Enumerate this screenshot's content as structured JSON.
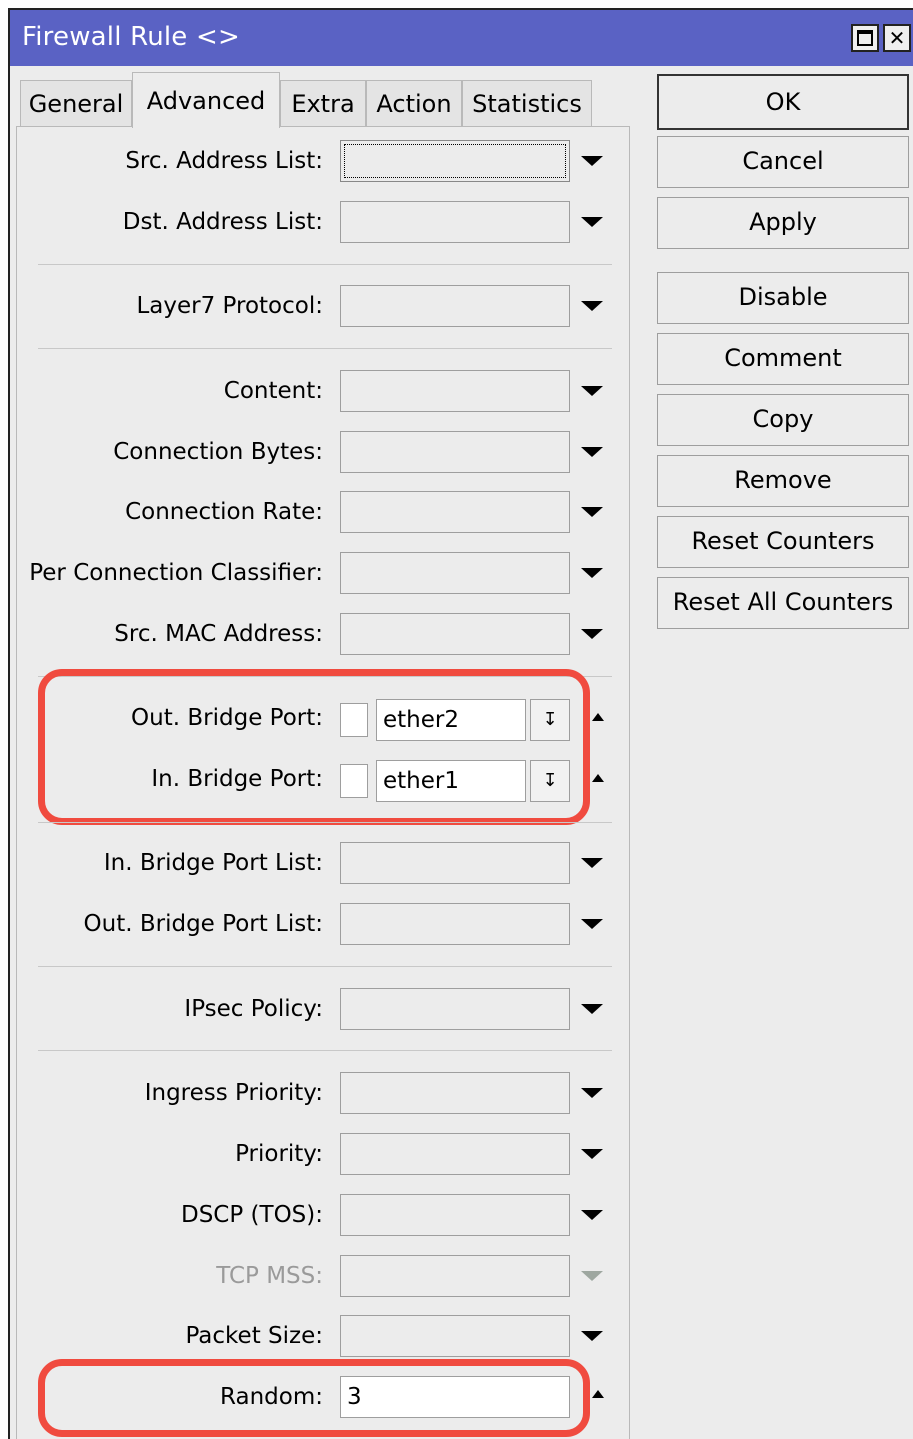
{
  "window": {
    "title": "Firewall Rule <>",
    "close_symbol": "✕"
  },
  "tabs": [
    "General",
    "Advanced",
    "Extra",
    "Action",
    "Statistics"
  ],
  "fields": {
    "src_address_list": "Src. Address List:",
    "dst_address_list": "Dst. Address List:",
    "layer7_protocol": "Layer7 Protocol:",
    "content": "Content:",
    "connection_bytes": "Connection Bytes:",
    "connection_rate": "Connection Rate:",
    "per_connection_classifier": "Per Connection Classifier:",
    "src_mac_address": "Src. MAC Address:",
    "out_bridge_port": "Out. Bridge Port:",
    "in_bridge_port": "In. Bridge Port:",
    "in_bridge_port_list": "In. Bridge Port List:",
    "out_bridge_port_list": "Out. Bridge Port List:",
    "ipsec_policy": "IPsec Policy:",
    "ingress_priority": "Ingress Priority:",
    "priority": "Priority:",
    "dscp_tos": "DSCP (TOS):",
    "tcp_mss": "TCP MSS:",
    "packet_size": "Packet Size:",
    "random": "Random:"
  },
  "values": {
    "out_bridge_port": "ether2",
    "in_bridge_port": "ether1",
    "random": "3"
  },
  "buttons": {
    "ok": "OK",
    "cancel": "Cancel",
    "apply": "Apply",
    "disable": "Disable",
    "comment": "Comment",
    "copy": "Copy",
    "remove": "Remove",
    "reset_counters": "Reset Counters",
    "reset_all_counters": "Reset All Counters"
  },
  "colors": {
    "titlebar": "#5a62c4",
    "highlight": "#f04b3f",
    "background": "#ececec"
  }
}
